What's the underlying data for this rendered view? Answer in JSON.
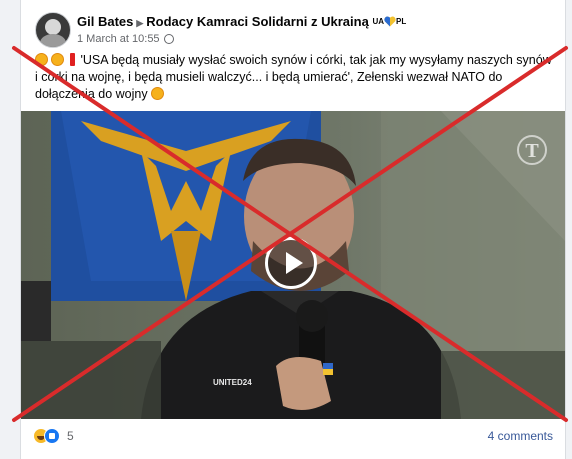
{
  "post": {
    "author": "Gil Bates",
    "group": "Rodacy Kamraci Solidarni z Ukrainą",
    "group_badge_left": "UA",
    "group_badge_right": "PL",
    "timestamp": "1 March at 10:55",
    "text": "'USA będą musiały wysłać swoich synów i córki, tak jak my wysyłamy naszych synów i córki na wojnę, i będą musieli walczyć... i będą umierać', Zełenski wezwał NATO do dołączenia do wojny"
  },
  "video": {
    "watermark": "T",
    "shirt_text": "UNITED24"
  },
  "footer": {
    "reaction_count": "5",
    "comments_label": "4 comments"
  },
  "colors": {
    "cross": "#d92b2b",
    "link": "#385898",
    "flag_blue": "#1f4fa0",
    "trident_gold": "#d9a021"
  }
}
